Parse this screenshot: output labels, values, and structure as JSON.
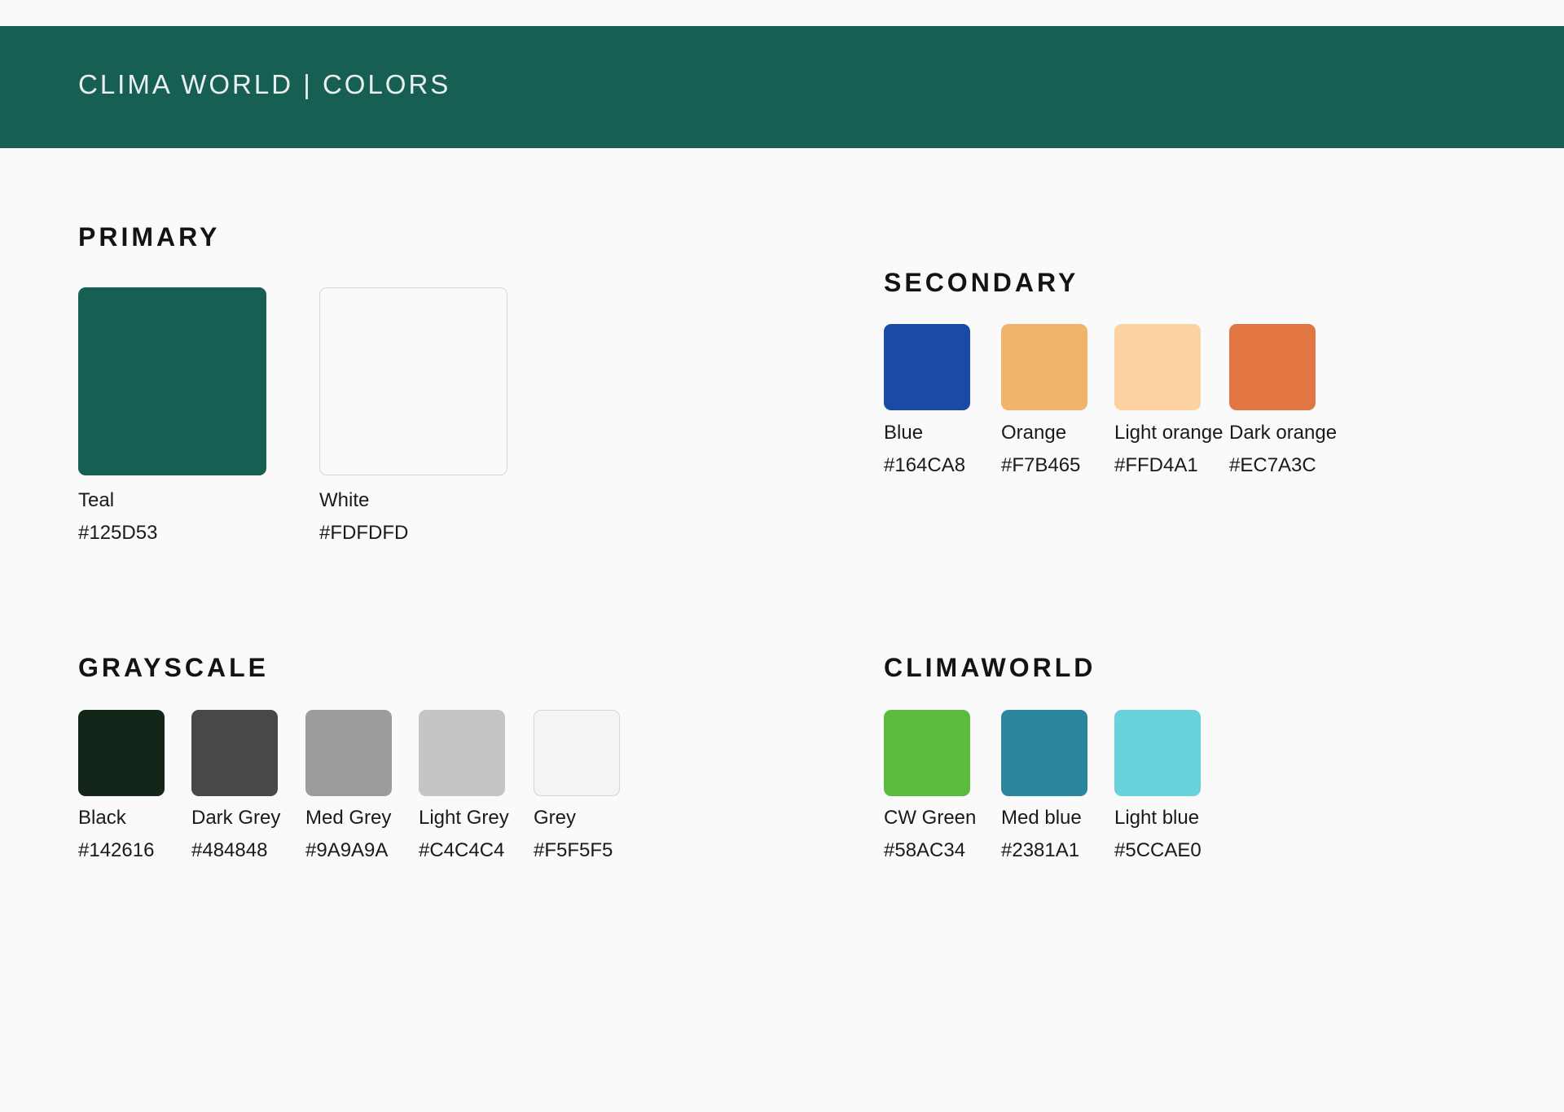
{
  "header": {
    "title": "CLIMA WORLD | COLORS"
  },
  "sections": {
    "primary": {
      "title": "PRIMARY",
      "colors": [
        {
          "name": "Teal",
          "hex": "#125D53",
          "fill": "#185F53"
        },
        {
          "name": "White",
          "hex": "#FDFDFD",
          "fill": "#FAFAFA"
        }
      ]
    },
    "secondary": {
      "title": "SECONDARY",
      "colors": [
        {
          "name": "Blue",
          "hex": "#164CA8",
          "fill": "#1B4AA6"
        },
        {
          "name": "Orange",
          "hex": "#F7B465",
          "fill": "#EFB36A"
        },
        {
          "name": "Light orange",
          "hex": "#FFD4A1",
          "fill": "#FBD2A0"
        },
        {
          "name": "Dark orange",
          "hex": "#EC7A3C",
          "fill": "#E27642"
        }
      ]
    },
    "grayscale": {
      "title": "GRAYSCALE",
      "colors": [
        {
          "name": "Black",
          "hex": "#142616",
          "fill": "#142619"
        },
        {
          "name": "Dark Grey",
          "hex": "#484848",
          "fill": "#484947"
        },
        {
          "name": "Med Grey",
          "hex": "#9A9A9A",
          "fill": "#9B9B9B"
        },
        {
          "name": "Light Grey",
          "hex": "#C4C4C4",
          "fill": "#C4C5C4"
        },
        {
          "name": "Grey",
          "hex": "#F5F5F5",
          "fill": "#F4F4F4"
        }
      ]
    },
    "climaworld": {
      "title": "CLIMAWORLD",
      "colors": [
        {
          "name": "CW Green",
          "hex": "#58AC34",
          "fill": "#5ABB3C"
        },
        {
          "name": "Med blue",
          "hex": "#2381A1",
          "fill": "#2A869C"
        },
        {
          "name": "Light blue",
          "hex": "#5CCAE0",
          "fill": "#69D2DC"
        }
      ]
    }
  }
}
